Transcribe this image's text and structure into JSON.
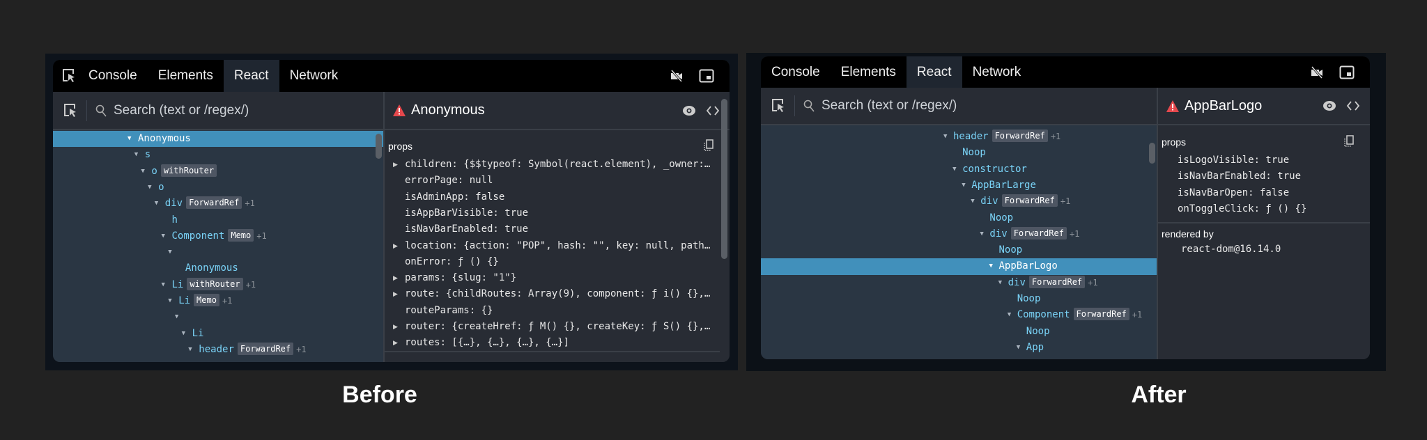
{
  "before": {
    "caption": "Before",
    "tabs": [
      "Console",
      "Elements",
      "React",
      "Network"
    ],
    "active_tab": "React",
    "search_placeholder": "Search (text or /regex/)",
    "selected_component": "Anonymous",
    "props_title": "props",
    "tree": [
      {
        "name": "Anonymous",
        "depth": 0,
        "toggle": true,
        "selected": true
      },
      {
        "name": "s",
        "depth": 1,
        "toggle": true
      },
      {
        "name": "o",
        "depth": 2,
        "toggle": true,
        "badge": "withRouter"
      },
      {
        "name": "o",
        "depth": 3,
        "toggle": true
      },
      {
        "name": "div",
        "depth": 4,
        "toggle": true,
        "badge": "ForwardRef",
        "extra": "+1"
      },
      {
        "name": "h",
        "depth": 5,
        "toggle": false
      },
      {
        "name": "Component",
        "depth": 5,
        "toggle": true,
        "badge": "Memo",
        "extra": "+1"
      },
      {
        "name": "",
        "depth": 6,
        "toggle": true
      },
      {
        "name": "Anonymous",
        "depth": 7,
        "toggle": false
      },
      {
        "name": "Li",
        "depth": 5,
        "toggle": true,
        "badge": "withRouter",
        "extra": "+1"
      },
      {
        "name": "Li",
        "depth": 6,
        "toggle": true,
        "badge": "Memo",
        "extra": "+1"
      },
      {
        "name": "",
        "depth": 7,
        "toggle": true
      },
      {
        "name": "Li",
        "depth": 8,
        "toggle": true
      },
      {
        "name": "header",
        "depth": 9,
        "toggle": true,
        "badge": "ForwardRef",
        "extra": "+1"
      }
    ],
    "props": [
      {
        "text": "children: {$$typeof: Symbol(react.element), _owner:…",
        "expandable": true
      },
      {
        "text": "errorPage: null",
        "expandable": false
      },
      {
        "text": "isAdminApp: false",
        "expandable": false
      },
      {
        "text": "isAppBarVisible: true",
        "expandable": false
      },
      {
        "text": "isNavBarEnabled: true",
        "expandable": false
      },
      {
        "text": "location: {action: \"POP\", hash: \"\", key: null, path…",
        "expandable": true
      },
      {
        "text": "onError: ƒ () {}",
        "expandable": false
      },
      {
        "text": "params: {slug: \"1\"}",
        "expandable": true
      },
      {
        "text": "route: {childRoutes: Array(9), component: ƒ i() {},…",
        "expandable": true
      },
      {
        "text": "routeParams: {}",
        "expandable": false
      },
      {
        "text": "router: {createHref: ƒ M() {}, createKey: ƒ S() {},…",
        "expandable": true
      },
      {
        "text": "routes: [{…}, {…}, {…}, {…}]",
        "expandable": true
      }
    ]
  },
  "after": {
    "caption": "After",
    "tabs": [
      "Console",
      "Elements",
      "React",
      "Network"
    ],
    "active_tab": "React",
    "search_placeholder": "Search (text or /regex/)",
    "selected_component": "AppBarLogo",
    "props_title": "props",
    "rendered_by_label": "rendered by",
    "rendered_by": "react-dom@16.14.0",
    "tree": [
      {
        "name": "header",
        "depth": 0,
        "toggle": true,
        "badge": "ForwardRef",
        "extra": "+1"
      },
      {
        "name": "Noop",
        "depth": 1,
        "toggle": false
      },
      {
        "name": "constructor",
        "depth": 1,
        "toggle": true
      },
      {
        "name": "AppBarLarge",
        "depth": 2,
        "toggle": true
      },
      {
        "name": "div",
        "depth": 3,
        "toggle": true,
        "badge": "ForwardRef",
        "extra": "+1"
      },
      {
        "name": "Noop",
        "depth": 4,
        "toggle": false
      },
      {
        "name": "div",
        "depth": 4,
        "toggle": true,
        "badge": "ForwardRef",
        "extra": "+1"
      },
      {
        "name": "Noop",
        "depth": 5,
        "toggle": false
      },
      {
        "name": "AppBarLogo",
        "depth": 5,
        "toggle": true,
        "selected": true
      },
      {
        "name": "div",
        "depth": 6,
        "toggle": true,
        "badge": "ForwardRef",
        "extra": "+1"
      },
      {
        "name": "Noop",
        "depth": 7,
        "toggle": false
      },
      {
        "name": "Component",
        "depth": 7,
        "toggle": true,
        "badge": "ForwardRef",
        "extra": "+1"
      },
      {
        "name": "Noop",
        "depth": 8,
        "toggle": false
      },
      {
        "name": "App",
        "depth": 8,
        "toggle": true
      }
    ],
    "props": [
      {
        "text": "isLogoVisible: true",
        "expandable": false
      },
      {
        "text": "isNavBarEnabled: true",
        "expandable": false
      },
      {
        "text": "isNavBarOpen: false",
        "expandable": false
      },
      {
        "text": "onToggleClick: ƒ () {}",
        "expandable": false
      }
    ]
  },
  "colors": {
    "selected_row": "#4190bb",
    "component_name": "#7ad3f7",
    "warning": "#e5484d",
    "badge": "#4e5663"
  }
}
